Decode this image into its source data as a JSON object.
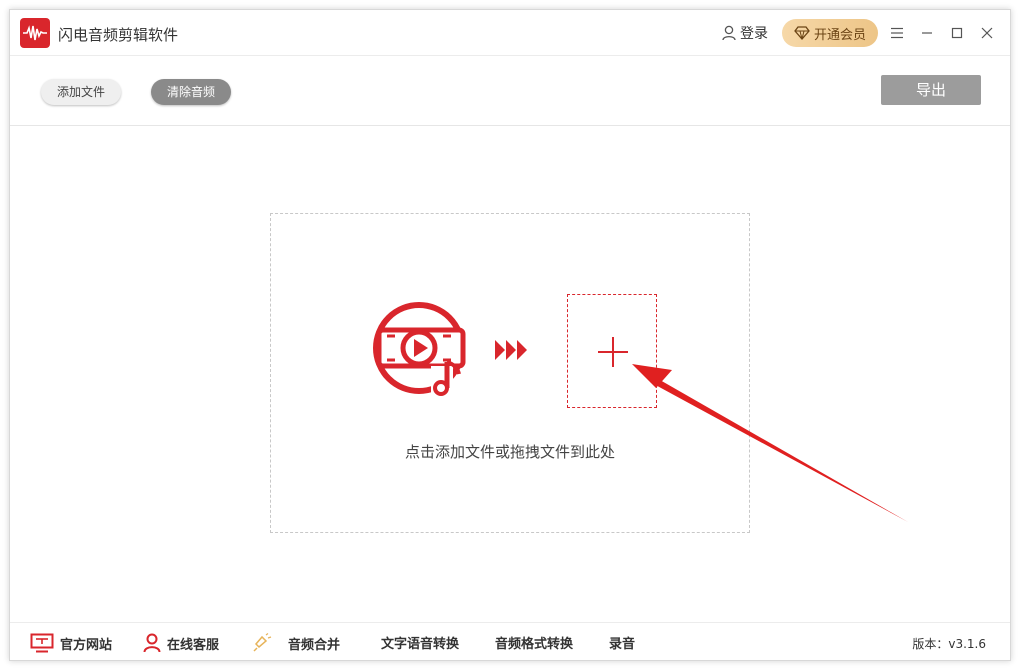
{
  "app": {
    "title": "闪电音频剪辑软件"
  },
  "header": {
    "login_label": "登录",
    "vip_label": "开通会员"
  },
  "toolbar": {
    "add_file_label": "添加文件",
    "clear_audio_label": "清除音频",
    "export_label": "导出"
  },
  "dropzone": {
    "hint": "点击添加文件或拖拽文件到此处"
  },
  "footer": {
    "items": [
      {
        "label": "官方网站",
        "icon": "monitor-icon"
      },
      {
        "label": "在线客服",
        "icon": "user-icon"
      },
      {
        "label": "音频合并",
        "icon": "bulb-icon"
      },
      {
        "label": "文字语音转换"
      },
      {
        "label": "音频格式转换"
      },
      {
        "label": "录音"
      }
    ],
    "version": "版本：v3.1.6"
  },
  "colors": {
    "brand_red": "#d9262c",
    "vip_gold": "#edc587",
    "export_gray": "#9c9c9c"
  }
}
